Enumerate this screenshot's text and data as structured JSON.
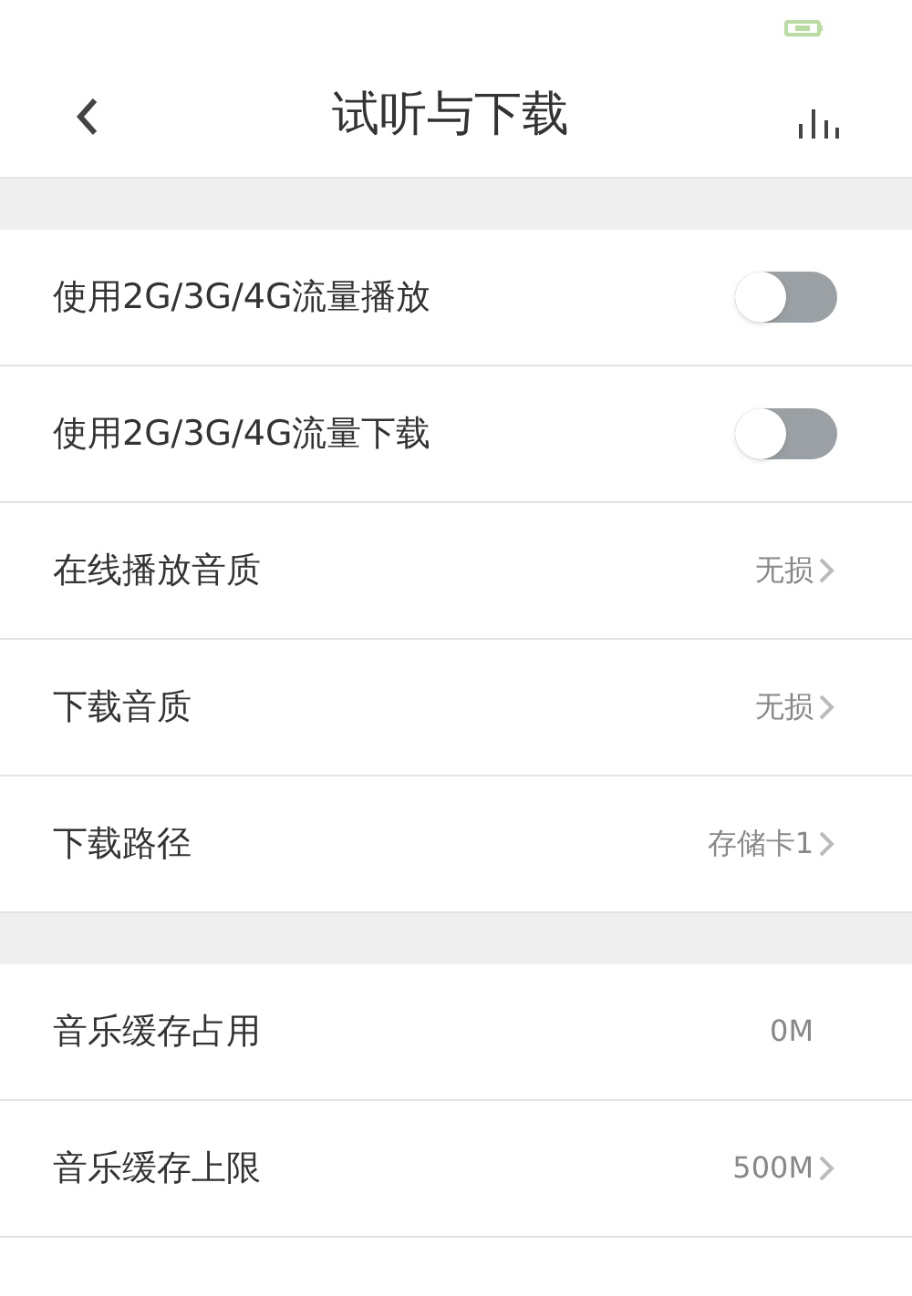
{
  "header": {
    "title": "试听与下载"
  },
  "sections": [
    {
      "rows": [
        {
          "kind": "toggle",
          "label": "使用2G/3G/4G流量播放",
          "on": false
        },
        {
          "kind": "toggle",
          "label": "使用2G/3G/4G流量下载",
          "on": false
        },
        {
          "kind": "link",
          "label": "在线播放音质",
          "value": "无损"
        },
        {
          "kind": "link",
          "label": "下载音质",
          "value": "无损"
        },
        {
          "kind": "link",
          "label": "下载路径",
          "value": "存储卡1"
        }
      ]
    },
    {
      "rows": [
        {
          "kind": "info",
          "label": "音乐缓存占用",
          "value": "0M"
        },
        {
          "kind": "link",
          "label": "音乐缓存上限",
          "value": "500M"
        }
      ]
    }
  ]
}
